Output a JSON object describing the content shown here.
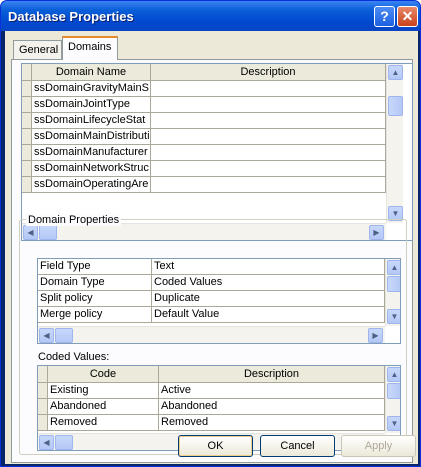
{
  "window": {
    "title": "Database Properties"
  },
  "tabs": [
    {
      "label": "General",
      "active": false
    },
    {
      "label": "Domains",
      "active": true
    }
  ],
  "domains_grid": {
    "columns": [
      "Domain Name",
      "Description"
    ],
    "rows": [
      {
        "name": "ssDomainGravityMainS",
        "description": ""
      },
      {
        "name": "ssDomainJointType",
        "description": ""
      },
      {
        "name": "ssDomainLifecycleStat",
        "description": ""
      },
      {
        "name": "ssDomainMainDistributi",
        "description": ""
      },
      {
        "name": "ssDomainManufacturer",
        "description": ""
      },
      {
        "name": "ssDomainNetworkStruc",
        "description": ""
      },
      {
        "name": "ssDomainOperatingAre",
        "description": ""
      }
    ]
  },
  "domain_properties": {
    "label": "Domain Properties",
    "rows": [
      {
        "property": "Field Type",
        "value": "Text"
      },
      {
        "property": "Domain Type",
        "value": "Coded Values"
      },
      {
        "property": "Split policy",
        "value": "Duplicate"
      },
      {
        "property": "Merge policy",
        "value": "Default Value"
      }
    ]
  },
  "coded_values": {
    "label": "Coded Values:",
    "columns": [
      "Code",
      "Description"
    ],
    "rows": [
      {
        "code": "Existing",
        "description": "Active"
      },
      {
        "code": "Abandoned",
        "description": "Abandoned"
      },
      {
        "code": "Removed",
        "description": "Removed"
      }
    ]
  },
  "buttons": {
    "ok": "OK",
    "cancel": "Cancel",
    "apply": "Apply"
  },
  "title_buttons": {
    "help": "?",
    "close": "✕"
  },
  "scroll_glyphs": {
    "up": "▲",
    "down": "▼",
    "left": "◀",
    "right": "▶"
  },
  "colors": {
    "titlebar": "#0054e3",
    "face": "#ece9d8",
    "accent_tab": "#e68b2c"
  }
}
